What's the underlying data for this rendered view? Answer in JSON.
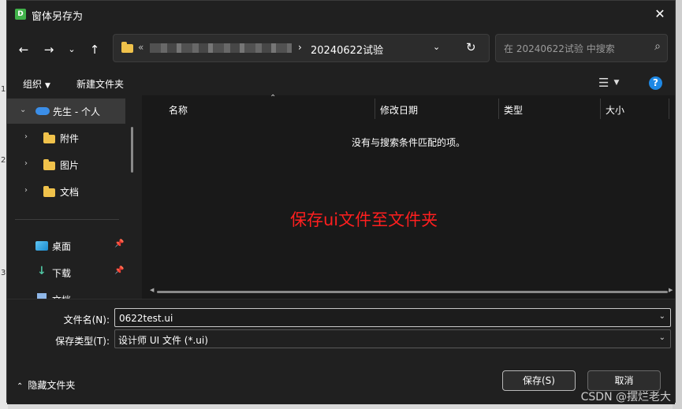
{
  "dialog": {
    "title": "窗体另存为",
    "app_icon_letter": "D"
  },
  "address": {
    "prefix": "«",
    "current_folder": "20240622试验"
  },
  "search": {
    "placeholder": "在 20240622试验 中搜索"
  },
  "toolbar": {
    "organize": "组织",
    "new_folder": "新建文件夹"
  },
  "nav": {
    "items": [
      {
        "label": "先生 - 个人",
        "icon": "cloud-icon"
      },
      {
        "label": "附件",
        "icon": "folder-icon"
      },
      {
        "label": "图片",
        "icon": "folder-icon"
      },
      {
        "label": "文档",
        "icon": "folder-icon"
      },
      {
        "label": "桌面",
        "icon": "desktop-icon"
      },
      {
        "label": "下载",
        "icon": "download-icon"
      },
      {
        "label": "文档",
        "icon": "document-icon"
      }
    ]
  },
  "columns": {
    "name": "名称",
    "modified": "修改日期",
    "type": "类型",
    "size": "大小"
  },
  "empty_message": "没有与搜索条件匹配的项。",
  "annotation": "保存ui文件至文件夹",
  "form": {
    "filename_label": "文件名(N):",
    "filename_value": "0622test.ui",
    "filetype_label": "保存类型(T):",
    "filetype_value": "设计师 UI 文件 (*.ui)"
  },
  "footer": {
    "hide_folders": "隐藏文件夹",
    "save": "保存(S)",
    "cancel": "取消"
  },
  "watermark": "CSDN @摆烂老大",
  "background": {
    "ruler_marks": [
      "1",
      "2",
      "3"
    ]
  },
  "colors": {
    "accent": "#1e88e5",
    "annotation": "#ff1f1f",
    "folder": "#f0c24b"
  }
}
